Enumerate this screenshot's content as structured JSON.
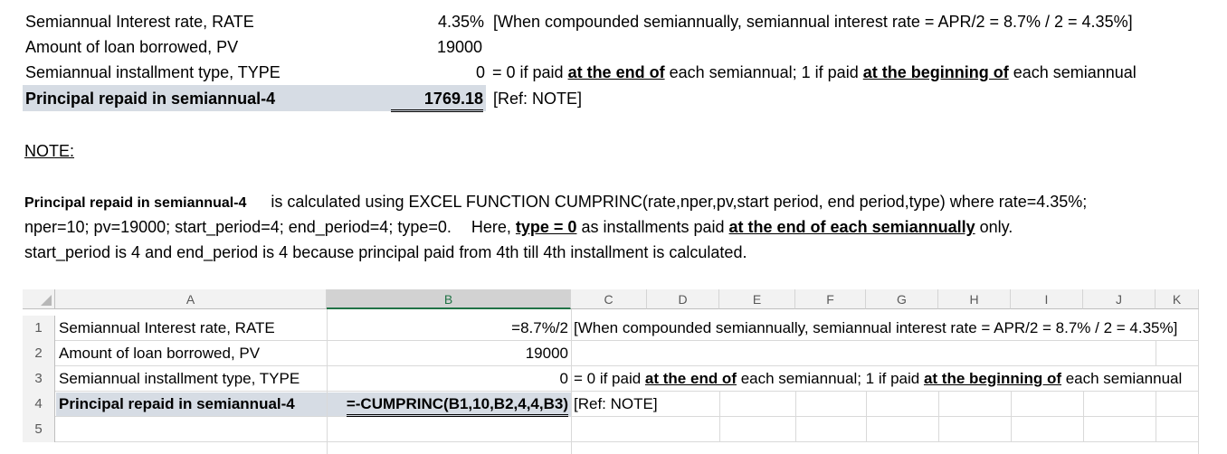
{
  "top": {
    "rows": [
      {
        "label": "Semiannual Interest rate, RATE",
        "value": "4.35%",
        "note": "[When compounded semiannually, semiannual interest rate = APR/2 = 8.7% / 2 = 4.35%]"
      },
      {
        "label": "Amount of loan borrowed, PV",
        "value": "19000"
      },
      {
        "label": "Semiannual installment type, TYPE",
        "value": "0",
        "note_parts": [
          "= 0 if paid ",
          "at the end of",
          " each semiannual; 1 if paid ",
          "at the beginning of",
          " each semiannual"
        ]
      },
      {
        "label": "Principal repaid in semiannual-4",
        "value": "1769.18",
        "note": "[Ref: NOTE]"
      }
    ]
  },
  "note": {
    "heading": "NOTE:",
    "bold_lead": "Principal repaid in semiannual-4",
    "line1": " is calculated using EXCEL FUNCTION CUMPRINC(rate,nper,pv,start period, end period,type) where rate=4.35%;",
    "line2_a": "nper=10; pv=19000; start_period=4; end_period=4; type=0.",
    "line2_b": "Here, ",
    "line2_c": "type = 0",
    "line2_d": " as installments paid ",
    "line2_e": "at the end of each semiannually",
    "line2_f": " only.",
    "line3": "start_period is 4 and end_period is 4 because principal paid from 4th till 4th installment is calculated."
  },
  "sheet": {
    "columns": [
      "A",
      "B",
      "C",
      "D",
      "E",
      "F",
      "G",
      "H",
      "I",
      "J",
      "K"
    ],
    "row_numbers": [
      "1",
      "2",
      "3",
      "4",
      "5"
    ],
    "a": [
      "Semiannual Interest rate, RATE",
      "Amount of loan borrowed, PV",
      "Semiannual installment type, TYPE",
      "Principal repaid in semiannual-4"
    ],
    "b": [
      "=8.7%/2",
      "19000",
      "0",
      "=-CUMPRINC(B1,10,B2,4,4,B3)"
    ],
    "c1": "[When compounded semiannually, semiannual interest rate = APR/2 = 8.7% / 2 = 4.35%]",
    "c2": "",
    "c3_parts": [
      "= 0 if paid ",
      "at the end of",
      " each semiannual; 1 if paid ",
      "at the beginning of",
      " each semiannual"
    ],
    "c4": "[Ref: NOTE]"
  },
  "colors": {
    "highlight": "#d6dce4",
    "header_bg": "#f2f2f2",
    "selected_header": "#d2d2d2"
  }
}
